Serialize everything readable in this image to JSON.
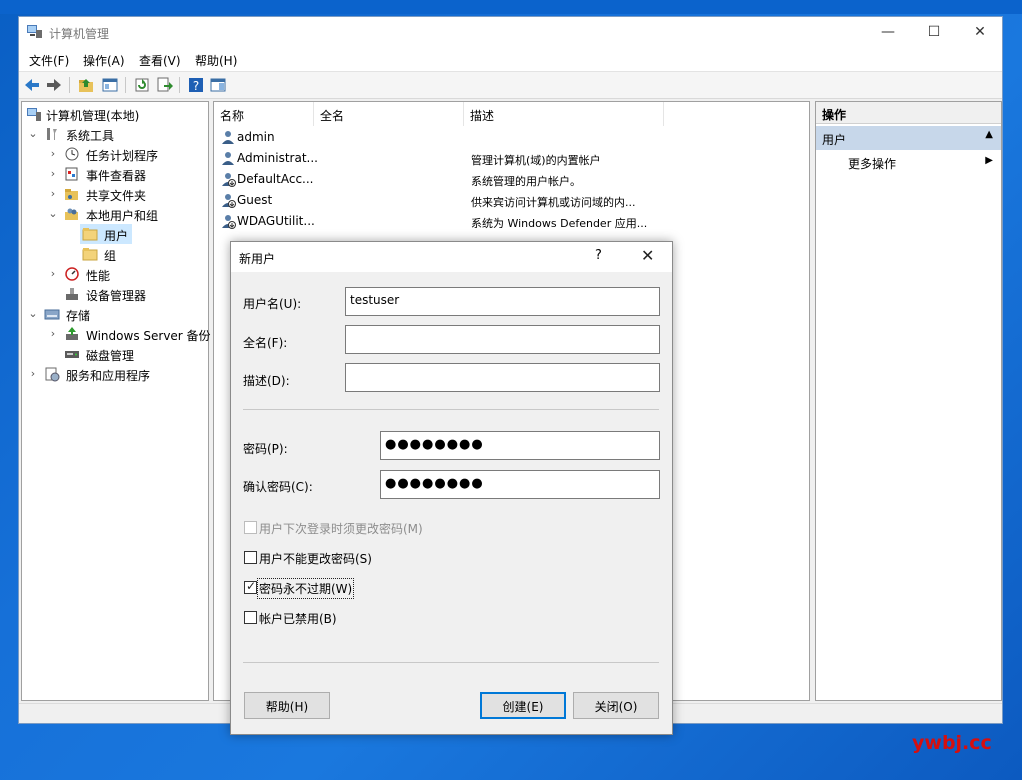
{
  "window": {
    "title": "计算机管理",
    "minimize": "—",
    "maximize": "☐",
    "close": "✕"
  },
  "menu": [
    "文件(F)",
    "操作(A)",
    "查看(V)",
    "帮助(H)"
  ],
  "tree": {
    "root": "计算机管理(本地)",
    "system_tools": "系统工具",
    "task_scheduler": "任务计划程序",
    "event_viewer": "事件查看器",
    "shared_folders": "共享文件夹",
    "local_users_groups": "本地用户和组",
    "users": "用户",
    "groups": "组",
    "performance": "性能",
    "device_manager": "设备管理器",
    "storage": "存储",
    "windows_server_backup": "Windows Server 备份",
    "disk_management": "磁盘管理",
    "services_apps": "服务和应用程序"
  },
  "list": {
    "columns": [
      "名称",
      "全名",
      "描述"
    ],
    "rows": [
      {
        "name": "admin",
        "fullname": "",
        "desc": ""
      },
      {
        "name": "Administrat...",
        "fullname": "",
        "desc": "管理计算机(域)的内置帐户"
      },
      {
        "name": "DefaultAcc...",
        "fullname": "",
        "desc": "系统管理的用户帐户。"
      },
      {
        "name": "Guest",
        "fullname": "",
        "desc": "供来宾访问计算机或访问域的内..."
      },
      {
        "name": "WDAGUtilit...",
        "fullname": "",
        "desc": "系统为 Windows Defender 应用..."
      }
    ]
  },
  "actions": {
    "header": "操作",
    "users": "用户",
    "more": "更多操作"
  },
  "dialog": {
    "title": "新用户",
    "help_glyph": "?",
    "close_glyph": "✕",
    "username_label": "用户名(U):",
    "username_value": "testuser",
    "fullname_label": "全名(F):",
    "fullname_value": "",
    "description_label": "描述(D):",
    "description_value": "",
    "password_label": "密码(P):",
    "password_value": "●●●●●●●●",
    "confirm_label": "确认密码(C):",
    "confirm_value": "●●●●●●●●",
    "cb_change_next_logon": {
      "label": "用户下次登录时须更改密码(M)",
      "checked": false,
      "disabled": true
    },
    "cb_cannot_change": {
      "label": "用户不能更改密码(S)",
      "checked": false,
      "disabled": false
    },
    "cb_never_expires": {
      "label": "密码永不过期(W)",
      "checked": true,
      "disabled": false
    },
    "cb_disabled": {
      "label": "帐户已禁用(B)",
      "checked": false,
      "disabled": false
    },
    "help_button": "帮助(H)",
    "create_button": "创建(E)",
    "close_button": "关闭(O)"
  },
  "watermark": "ywbj.cc",
  "colors": {
    "accent": "#0078d7",
    "selection": "#cce8ff",
    "action_band": "#c7d7ea",
    "watermark": "#d60f0f"
  }
}
